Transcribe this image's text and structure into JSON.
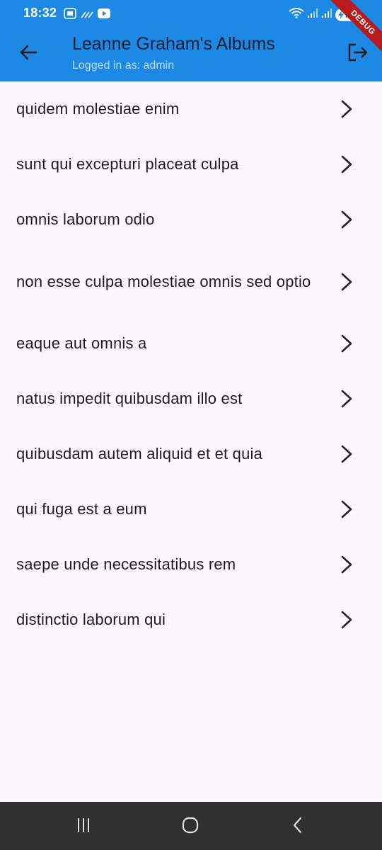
{
  "status_bar": {
    "time": "18:32",
    "battery": "72",
    "left_icons": [
      "screenshot-icon",
      "signal-boost-icon",
      "youtube-icon"
    ],
    "right_icons": [
      "wifi-icon",
      "cell-signal-icon",
      "cell-signal-icon",
      "battery-icon"
    ]
  },
  "debug_banner": "DEBUG",
  "app_bar": {
    "title": "Leanne Graham's Albums",
    "subtitle": "Logged in as: admin",
    "background_color": "#1e88e5",
    "back_icon": "arrow-back-icon",
    "logout_icon": "logout-icon"
  },
  "albums": [
    {
      "title": "quidem molestiae enim"
    },
    {
      "title": "sunt qui excepturi placeat culpa"
    },
    {
      "title": "omnis laborum odio"
    },
    {
      "title": "non esse culpa molestiae omnis sed optio"
    },
    {
      "title": "eaque aut omnis a"
    },
    {
      "title": "natus impedit quibusdam illo est"
    },
    {
      "title": "quibusdam autem aliquid et et quia"
    },
    {
      "title": "qui fuga est a eum"
    },
    {
      "title": "saepe unde necessitatibus rem"
    },
    {
      "title": "distinctio laborum qui"
    }
  ],
  "nav_bar": {
    "buttons": [
      "recent-apps-icon",
      "home-icon",
      "back-icon"
    ]
  }
}
